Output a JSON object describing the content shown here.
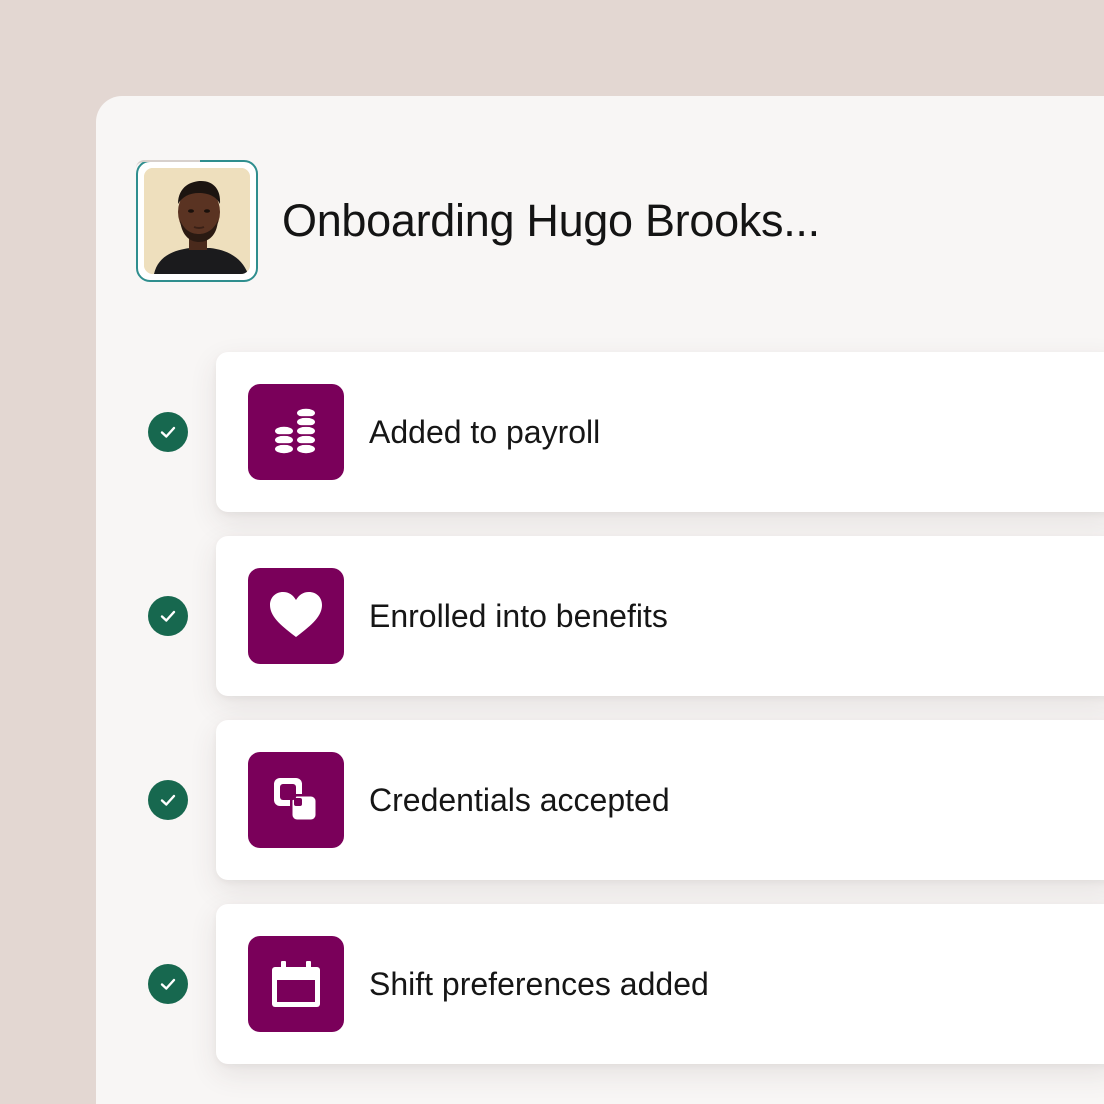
{
  "header": {
    "title": "Onboarding Hugo Brooks..."
  },
  "steps": [
    {
      "label": "Added to payroll",
      "icon": "coins-icon",
      "status": "completed"
    },
    {
      "label": "Enrolled into benefits",
      "icon": "heart-icon",
      "status": "completed"
    },
    {
      "label": "Credentials accepted",
      "icon": "credentials-icon",
      "status": "completed"
    },
    {
      "label": "Shift preferences added",
      "icon": "calendar-icon",
      "status": "completed"
    }
  ],
  "colors": {
    "background": "#e3d7d2",
    "panel": "#f8f6f5",
    "icon_tile": "#7a005a",
    "check": "#17684f",
    "avatar_ring": "#2f8e8e"
  }
}
